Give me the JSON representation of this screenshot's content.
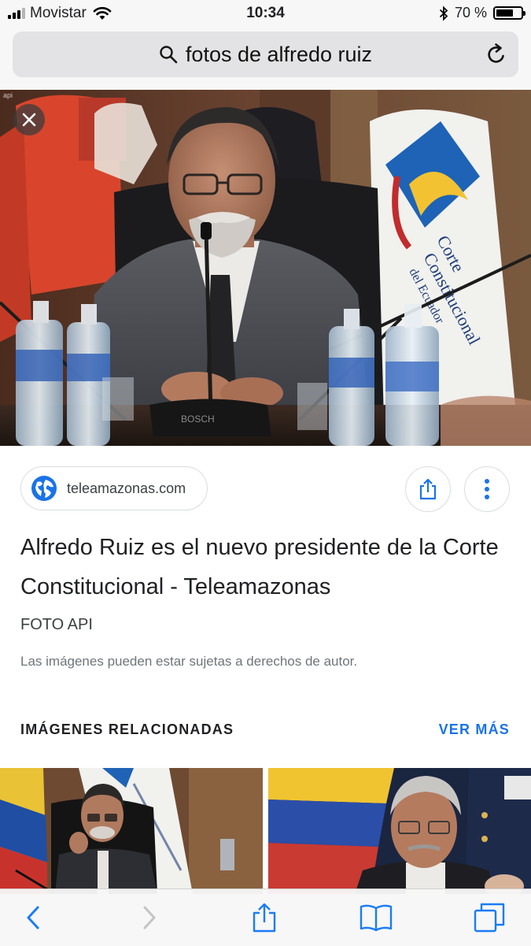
{
  "status_bar": {
    "carrier": "Movistar",
    "time": "10:34",
    "battery_text": "70 %",
    "battery_level": 0.7,
    "signal_bars_active": 3
  },
  "url_bar": {
    "query": "fotos de alfredo ruiz"
  },
  "source": {
    "domain": "teleamazonas.com"
  },
  "result": {
    "title": "Alfredo Ruiz es el nuevo presidente de la Corte Constitucional - Teleamazonas",
    "credit": "FOTO API",
    "copyright_notice": "Las imágenes pueden estar sujetas a derechos de autor."
  },
  "related": {
    "heading": "IMÁGENES RELACIONADAS",
    "see_more": "VER MÁS"
  },
  "hero_image": {
    "watermark": "api",
    "flag_text": [
      "Corte",
      "Constitucional",
      "del Ecuador"
    ],
    "microphone_brand": "BOSCH"
  },
  "colors": {
    "accent": "#1a73e8",
    "toolbar_icon": "#1a7cf5",
    "toolbar_icon_disabled": "#c4c4c6"
  },
  "icons": {
    "search": "search-icon",
    "reload": "reload-icon",
    "close": "close-icon",
    "globe": "globe-icon",
    "share": "share-icon",
    "more": "more-vert-icon",
    "back": "chevron-left-icon",
    "forward": "chevron-right-icon",
    "bookmarks": "book-icon",
    "tabs": "tabs-icon"
  }
}
